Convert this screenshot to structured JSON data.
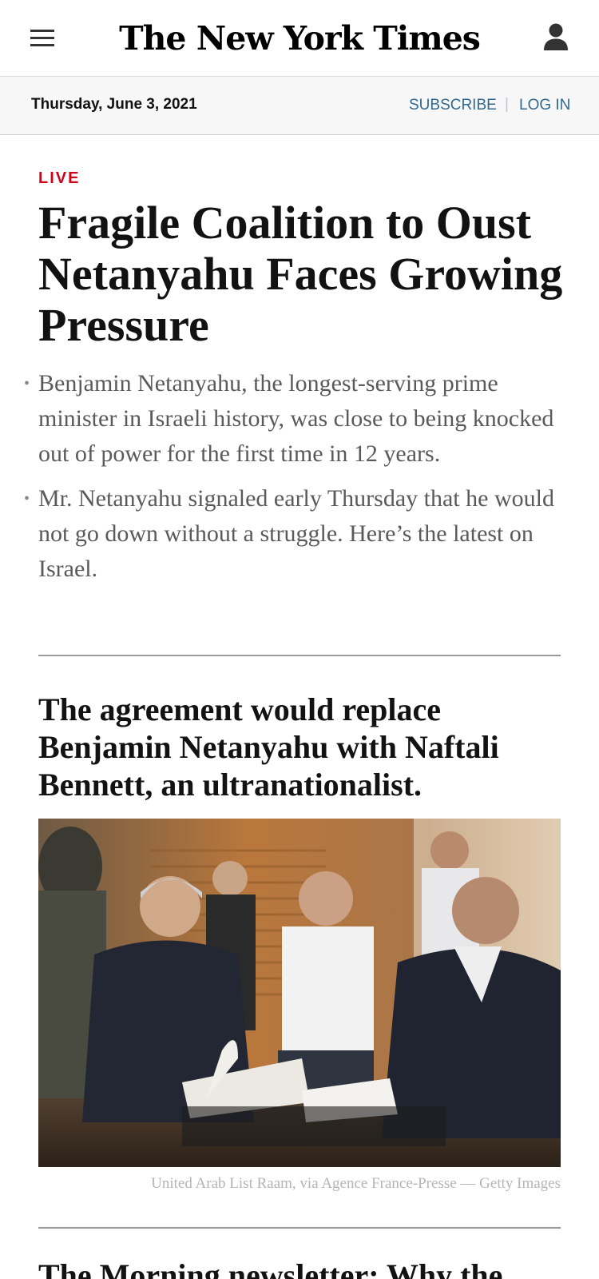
{
  "masthead": {
    "logo_text": "The New York Times",
    "menu_icon": "hamburger-menu-icon",
    "account_icon": "user-account-icon"
  },
  "datebar": {
    "date": "Thursday, June 3, 2021",
    "subscribe_label": "SUBSCRIBE",
    "divider": "|",
    "login_label": "LOG IN"
  },
  "story": {
    "live_label": "LIVE",
    "headline": "Fragile Coalition to Oust Netanyahu Faces Growing Pressure",
    "summary": [
      "Benjamin Netanyahu, the longest-serving prime minister in Israeli history, was close to being knocked out of power for the first time in 12 years.",
      "Mr. Netanyahu signaled early Thursday that he would not go down without a struggle. Here’s the latest on Israel."
    ]
  },
  "secondary": {
    "headline": "The agreement would replace Benjamin Netanyahu with Naftali Bennett, an ultranationalist.",
    "photo_credit": "United Arab List Raam, via Agence France-Presse — Getty Images"
  },
  "next_story": {
    "headline": "The Morning newsletter: Why the"
  },
  "colors": {
    "live_red": "#d0021b",
    "link_blue": "#326891",
    "datebar_bg": "#f7f7f7"
  }
}
